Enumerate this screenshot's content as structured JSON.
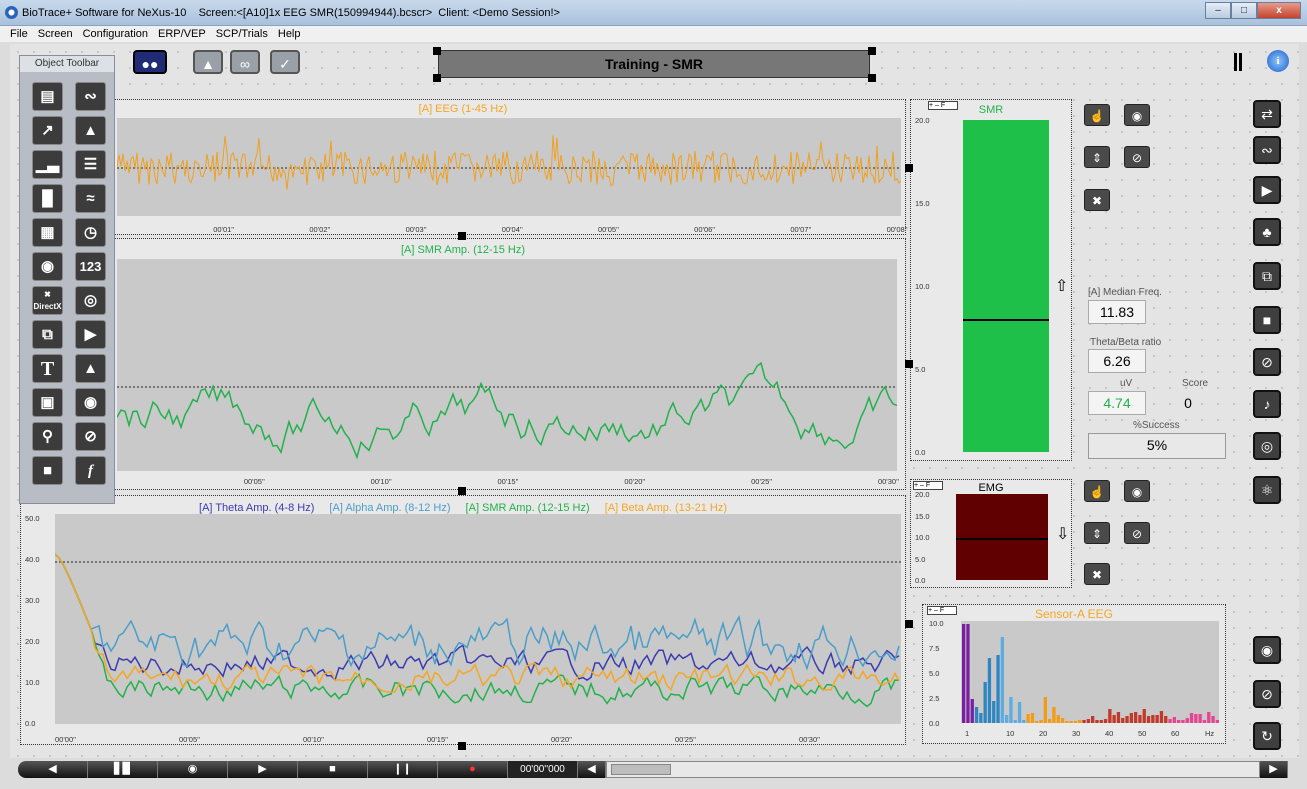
{
  "window": {
    "title": "BioTrace+ Software for NeXus-10    Screen:<[A10]1x EEG SMR(150994944).bcscr>  Client: <Demo Session!>",
    "minimize": "–",
    "maximize": "□",
    "close": "x"
  },
  "menu": [
    "File",
    "Screen",
    "Configuration",
    "ERP/VEP",
    "SCP/Trials",
    "Help"
  ],
  "screen_title": "Training - SMR",
  "object_toolbar": {
    "title": "Object Toolbar",
    "directx_label": "DirectX",
    "number_label": "123"
  },
  "eeg": {
    "title": "[A] EEG (1-45 Hz)",
    "ticks": [
      "00'01''",
      "00'02''",
      "00'03''",
      "00'04''",
      "00'05''",
      "00'06''",
      "00'07''",
      "00'08''"
    ]
  },
  "smr": {
    "title": "[A] SMR Amp. (12-15 Hz)",
    "ticks": [
      "00'05''",
      "00'10''",
      "00'15''",
      "00'20''",
      "00'25''",
      "00'30''"
    ]
  },
  "multi": {
    "legend": [
      "[A] Theta Amp. (4-8 Hz)",
      "[A] Alpha Amp. (8-12 Hz)",
      "[A] SMR Amp. (12-15 Hz)",
      "[A] Beta Amp. (13-21 Hz)"
    ],
    "colors": [
      "#3b3bb0",
      "#4a9ec9",
      "#22b14c",
      "#f5a623"
    ],
    "yticks": [
      "50.0",
      "40.0",
      "30.0",
      "20.0",
      "10.0",
      "0.0"
    ],
    "xticks": [
      "00'00''",
      "00'05''",
      "00'10''",
      "00'15''",
      "00'20''",
      "00'25''",
      "00'30''"
    ]
  },
  "smr_bar": {
    "title": "SMR",
    "yticks": [
      "20.0",
      "15.0",
      "10.0",
      "5.0",
      "0.0"
    ],
    "value": 7.9,
    "max": 20,
    "color": "#1fc04a",
    "arrow": "⇧"
  },
  "emg_bar": {
    "title": "EMG",
    "yticks": [
      "20.0",
      "15.0",
      "10.0",
      "5.0",
      "0.0"
    ],
    "value": 9.2,
    "max": 20,
    "color": "#600000",
    "arrow": "⇩"
  },
  "stats": {
    "median_label": "[A] Median Freq.",
    "median_value": "11.83",
    "ratio_label": "Theta/Beta ratio",
    "ratio_value": "6.26",
    "uv_label": "uV",
    "uv_value": "4.74",
    "score_label": "Score",
    "score_value": "0",
    "success_label": "%Success",
    "success_value": "5%"
  },
  "spectrum": {
    "title": "Sensor-A EEG",
    "yticks": [
      "10.0",
      "7.5",
      "5.0",
      "2.5",
      "0.0"
    ],
    "xticks": [
      "1",
      "10",
      "20",
      "30",
      "40",
      "50",
      "60"
    ],
    "unit": "Hz"
  },
  "transport": {
    "time": "00'00''000"
  },
  "chart_data": {
    "type": "bar",
    "title": "Sensor-A EEG",
    "xlabel": "Hz",
    "ylim": [
      0,
      10
    ],
    "categories": [
      1,
      2,
      3,
      4,
      5,
      6,
      7,
      8,
      9,
      10,
      11,
      12,
      13,
      14,
      15,
      16,
      17,
      18,
      19,
      20,
      21,
      22,
      23,
      24,
      25,
      26,
      27,
      28,
      29,
      30,
      31,
      32,
      33,
      34,
      35,
      36,
      37,
      38,
      39,
      40,
      41,
      42,
      43,
      44,
      45,
      46,
      47,
      48,
      49,
      50,
      51,
      52,
      53,
      54,
      55,
      56,
      57,
      58,
      59,
      60
    ],
    "values": [
      9.9,
      9.9,
      2.4,
      1.6,
      1.0,
      4.1,
      6.5,
      2.2,
      6.8,
      8.6,
      0.8,
      2.6,
      0.3,
      2.1,
      0.3,
      0.9,
      1.0,
      0.2,
      0.3,
      2.6,
      0.4,
      1.6,
      0.8,
      0.5,
      0.2,
      0.2,
      0.2,
      0.3,
      0.3,
      0.4,
      0.7,
      0.3,
      0.3,
      0.4,
      1.4,
      0.8,
      1.1,
      0.5,
      0.7,
      1.0,
      1.1,
      0.8,
      1.4,
      0.7,
      0.8,
      0.8,
      1.2,
      0.7,
      0.4,
      0.6,
      0.3,
      0.3,
      0.5,
      1.0,
      0.9,
      0.9,
      0.3,
      1.1,
      0.7,
      0.3
    ]
  }
}
